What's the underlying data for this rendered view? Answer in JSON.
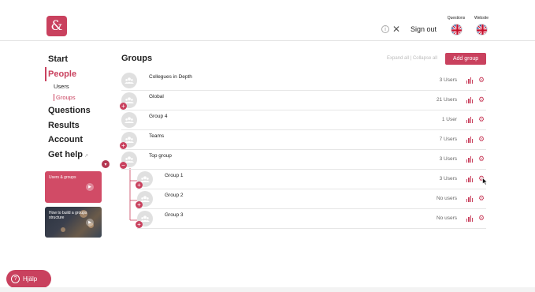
{
  "header": {
    "logo": "&",
    "info_icon": "i",
    "sign_out": "Sign out",
    "questions_label": "Questions",
    "website_label": "Website"
  },
  "sidebar": {
    "items": [
      {
        "label": "Start"
      },
      {
        "label": "People"
      },
      {
        "label": "Questions"
      },
      {
        "label": "Results"
      },
      {
        "label": "Account"
      },
      {
        "label": "Get help"
      }
    ],
    "sub_items": [
      {
        "label": "Users"
      },
      {
        "label": "Groups"
      }
    ],
    "cards": [
      {
        "title": "Users & groups"
      },
      {
        "title": "How to build a groups structure"
      }
    ]
  },
  "help_button": {
    "label": "Hjälp"
  },
  "main": {
    "title": "Groups",
    "expand_all": "Expand all",
    "separator": "|",
    "collapse_all": "Collapse all",
    "add_group": "Add group",
    "groups": [
      {
        "name": "Collegues in Depth",
        "users": "3 Users"
      },
      {
        "name": "Global",
        "users": "21 Users"
      },
      {
        "name": "Group 4",
        "users": "1 User"
      },
      {
        "name": "Teams",
        "users": "7 Users"
      },
      {
        "name": "Top group",
        "users": "3 Users"
      },
      {
        "name": "Group 1",
        "users": "3 Users"
      },
      {
        "name": "Group 2",
        "users": "No users"
      },
      {
        "name": "Group 3",
        "users": "No users"
      }
    ]
  },
  "colors": {
    "accent": "#c9415e",
    "text": "#222222",
    "muted": "#666666"
  }
}
